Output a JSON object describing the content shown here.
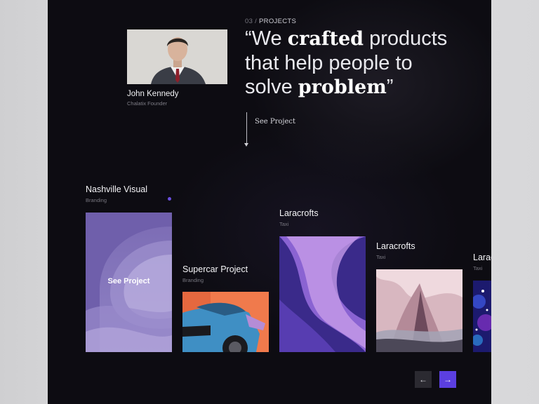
{
  "section": {
    "number": "03",
    "separator": "/",
    "label": "PROJECTS"
  },
  "quote": {
    "open": "“We ",
    "bold1": "crafted",
    "mid": " products that help people to solve ",
    "bold2": "problem",
    "close": "”"
  },
  "person": {
    "name": "John Kennedy",
    "role": "Chalatix Founder"
  },
  "see_project_link": "See Project",
  "cards": [
    {
      "title": "Nashville Visual",
      "category": "Branding",
      "overlay": "See Project"
    },
    {
      "title": "Supercar Project",
      "category": "Branding"
    },
    {
      "title": "Laracrofts",
      "category": "Taxi"
    },
    {
      "title": "Laracrofts",
      "category": "Taxi"
    },
    {
      "title": "Laracrofts",
      "category": "Taxi"
    }
  ],
  "nav": {
    "prev_icon": "arrow-left-icon",
    "next_icon": "arrow-right-icon",
    "prev_glyph": "←",
    "next_glyph": "→"
  },
  "colors": {
    "accent": "#5b3fe0",
    "background": "#0d0c12"
  }
}
